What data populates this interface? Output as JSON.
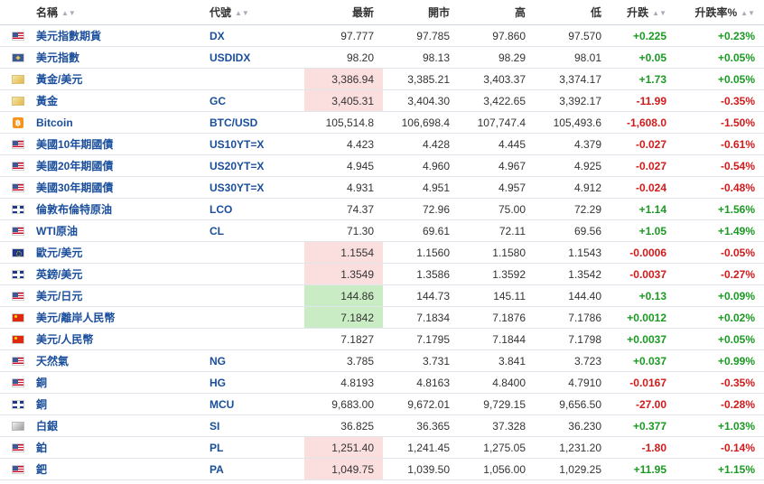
{
  "headers": {
    "name": "名稱",
    "code": "代號",
    "last": "最新",
    "open": "開市",
    "high": "高",
    "low": "低",
    "change": "升跌",
    "change_pct": "升跌率%"
  },
  "rows": [
    {
      "flag": "us",
      "name": "美元指數期貨",
      "code": "DX",
      "last": "97.777",
      "open": "97.785",
      "high": "97.860",
      "low": "97.570",
      "change": "+0.225",
      "change_pct": "+0.23%",
      "dir": "pos",
      "hl": ""
    },
    {
      "flag": "dx",
      "name": "美元指數",
      "code": "USDIDX",
      "last": "98.20",
      "open": "98.13",
      "high": "98.29",
      "low": "98.01",
      "change": "+0.05",
      "change_pct": "+0.05%",
      "dir": "pos",
      "hl": ""
    },
    {
      "flag": "gold",
      "name": "黃金/美元",
      "code": "",
      "last": "3,386.94",
      "open": "3,385.21",
      "high": "3,403.37",
      "low": "3,374.17",
      "change": "+1.73",
      "change_pct": "+0.05%",
      "dir": "pos",
      "hl": "neg"
    },
    {
      "flag": "gold",
      "name": "黃金",
      "code": "GC",
      "last": "3,405.31",
      "open": "3,404.30",
      "high": "3,422.65",
      "low": "3,392.17",
      "change": "-11.99",
      "change_pct": "-0.35%",
      "dir": "neg",
      "hl": "neg"
    },
    {
      "flag": "btc",
      "name": "Bitcoin",
      "code": "BTC/USD",
      "last": "105,514.8",
      "open": "106,698.4",
      "high": "107,747.4",
      "low": "105,493.6",
      "change": "-1,608.0",
      "change_pct": "-1.50%",
      "dir": "neg",
      "hl": ""
    },
    {
      "flag": "us",
      "name": "美國10年期國債",
      "code": "US10YT=X",
      "last": "4.423",
      "open": "4.428",
      "high": "4.445",
      "low": "4.379",
      "change": "-0.027",
      "change_pct": "-0.61%",
      "dir": "neg",
      "hl": ""
    },
    {
      "flag": "us",
      "name": "美國20年期國債",
      "code": "US20YT=X",
      "last": "4.945",
      "open": "4.960",
      "high": "4.967",
      "low": "4.925",
      "change": "-0.027",
      "change_pct": "-0.54%",
      "dir": "neg",
      "hl": ""
    },
    {
      "flag": "us",
      "name": "美國30年期國債",
      "code": "US30YT=X",
      "last": "4.931",
      "open": "4.951",
      "high": "4.957",
      "low": "4.912",
      "change": "-0.024",
      "change_pct": "-0.48%",
      "dir": "neg",
      "hl": ""
    },
    {
      "flag": "gb",
      "name": "倫敦布倫特原油",
      "code": "LCO",
      "last": "74.37",
      "open": "72.96",
      "high": "75.00",
      "low": "72.29",
      "change": "+1.14",
      "change_pct": "+1.56%",
      "dir": "pos",
      "hl": ""
    },
    {
      "flag": "us",
      "name": "WTI原油",
      "code": "CL",
      "last": "71.30",
      "open": "69.61",
      "high": "72.11",
      "low": "69.56",
      "change": "+1.05",
      "change_pct": "+1.49%",
      "dir": "pos",
      "hl": ""
    },
    {
      "flag": "eu",
      "name": "歐元/美元",
      "code": "",
      "last": "1.1554",
      "open": "1.1560",
      "high": "1.1580",
      "low": "1.1543",
      "change": "-0.0006",
      "change_pct": "-0.05%",
      "dir": "neg",
      "hl": "neg"
    },
    {
      "flag": "gb",
      "name": "英鎊/美元",
      "code": "",
      "last": "1.3549",
      "open": "1.3586",
      "high": "1.3592",
      "low": "1.3542",
      "change": "-0.0037",
      "change_pct": "-0.27%",
      "dir": "neg",
      "hl": "neg"
    },
    {
      "flag": "us",
      "name": "美元/日元",
      "code": "",
      "last": "144.86",
      "open": "144.73",
      "high": "145.11",
      "low": "144.40",
      "change": "+0.13",
      "change_pct": "+0.09%",
      "dir": "pos",
      "hl": "pos"
    },
    {
      "flag": "cn",
      "name": "美元/離岸人民幣",
      "code": "",
      "last": "7.1842",
      "open": "7.1834",
      "high": "7.1876",
      "low": "7.1786",
      "change": "+0.0012",
      "change_pct": "+0.02%",
      "dir": "pos",
      "hl": "pos"
    },
    {
      "flag": "cn",
      "name": "美元/人民幣",
      "code": "",
      "last": "7.1827",
      "open": "7.1795",
      "high": "7.1844",
      "low": "7.1798",
      "change": "+0.0037",
      "change_pct": "+0.05%",
      "dir": "pos",
      "hl": ""
    },
    {
      "flag": "us",
      "name": "天然氣",
      "code": "NG",
      "last": "3.785",
      "open": "3.731",
      "high": "3.841",
      "low": "3.723",
      "change": "+0.037",
      "change_pct": "+0.99%",
      "dir": "pos",
      "hl": ""
    },
    {
      "flag": "us",
      "name": "銅",
      "code": "HG",
      "last": "4.8193",
      "open": "4.8163",
      "high": "4.8400",
      "low": "4.7910",
      "change": "-0.0167",
      "change_pct": "-0.35%",
      "dir": "neg",
      "hl": ""
    },
    {
      "flag": "gb",
      "name": "銅",
      "code": "MCU",
      "last": "9,683.00",
      "open": "9,672.01",
      "high": "9,729.15",
      "low": "9,656.50",
      "change": "-27.00",
      "change_pct": "-0.28%",
      "dir": "neg",
      "hl": ""
    },
    {
      "flag": "silver",
      "name": "白銀",
      "code": "SI",
      "last": "36.825",
      "open": "36.365",
      "high": "37.328",
      "low": "36.230",
      "change": "+0.377",
      "change_pct": "+1.03%",
      "dir": "pos",
      "hl": ""
    },
    {
      "flag": "us",
      "name": "鉑",
      "code": "PL",
      "last": "1,251.40",
      "open": "1,241.45",
      "high": "1,275.05",
      "low": "1,231.20",
      "change": "-1.80",
      "change_pct": "-0.14%",
      "dir": "neg",
      "hl": "neg"
    },
    {
      "flag": "us",
      "name": "鈀",
      "code": "PA",
      "last": "1,049.75",
      "open": "1,039.50",
      "high": "1,056.00",
      "low": "1,029.25",
      "change": "+11.95",
      "change_pct": "+1.15%",
      "dir": "pos",
      "hl": "neg"
    }
  ]
}
